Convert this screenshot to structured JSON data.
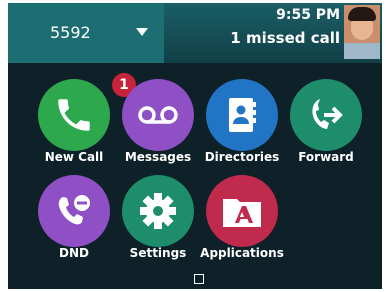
{
  "header": {
    "line_number": "5592",
    "time": "9:55 PM",
    "missed_calls": "1 missed call"
  },
  "apps": [
    {
      "label": "New Call",
      "color": "#2ea84c",
      "icon": "phone-icon",
      "badge": "1"
    },
    {
      "label": "Messages",
      "color": "#8f4fc5",
      "icon": "voicemail-icon"
    },
    {
      "label": "Directories",
      "color": "#2274c4",
      "icon": "contacts-book-icon"
    },
    {
      "label": "Forward",
      "color": "#1e8d6b",
      "icon": "call-forward-icon"
    },
    {
      "label": "DND",
      "color": "#8f4fc5",
      "icon": "do-not-disturb-phone-icon"
    },
    {
      "label": "Settings",
      "color": "#1e8d6b",
      "icon": "gear-icon"
    },
    {
      "label": "Applications",
      "color": "#bf2a4d",
      "icon": "applications-folder-icon"
    }
  ],
  "colors": {
    "background": "#0e2128",
    "line_key": "#1d6e72",
    "status_bar": "#1a5e66",
    "badge": "#c8233a"
  }
}
